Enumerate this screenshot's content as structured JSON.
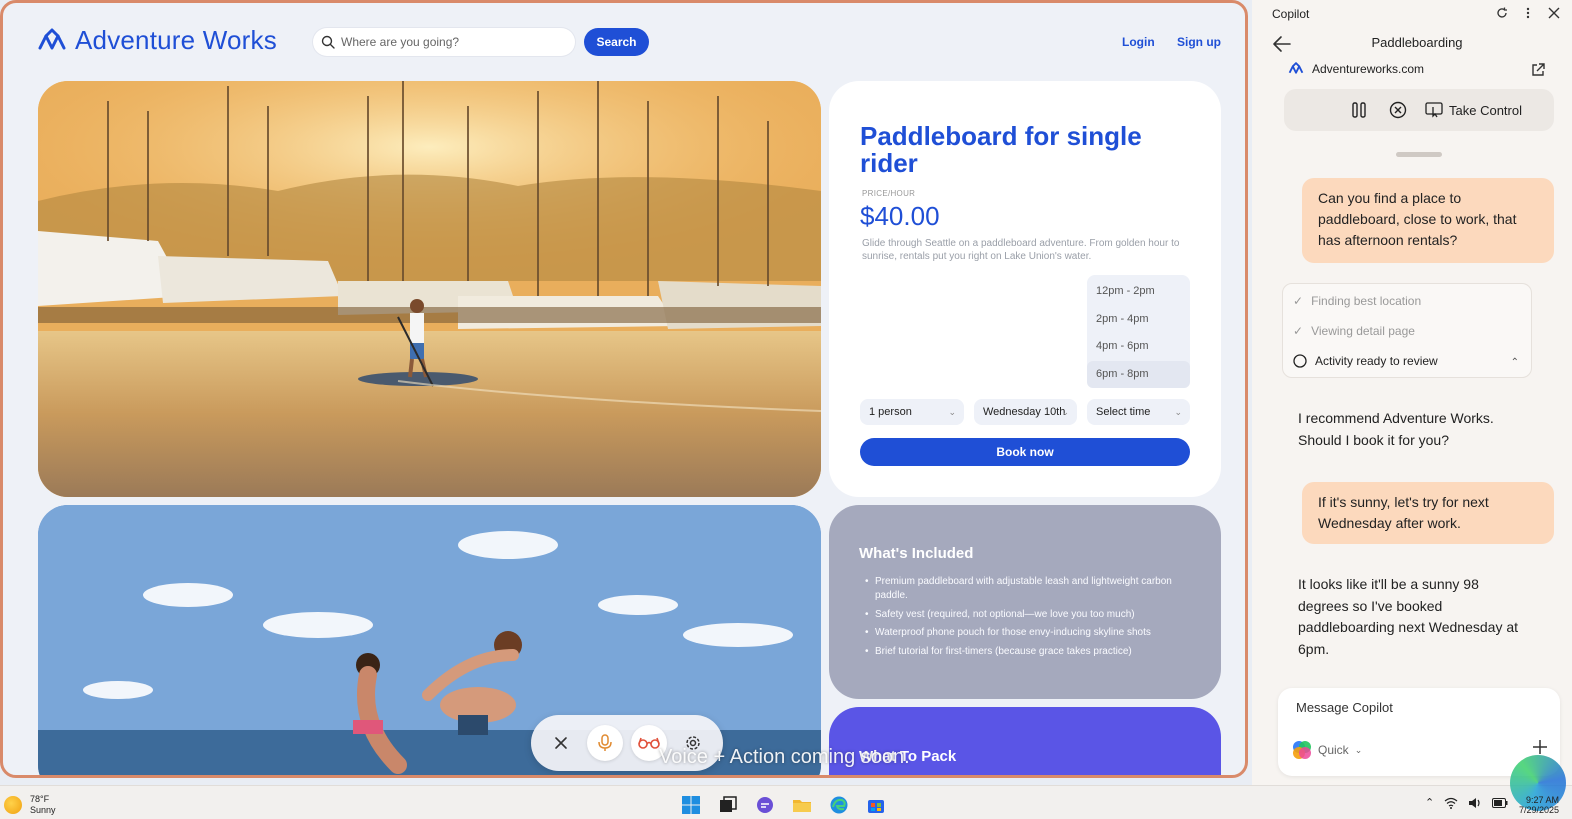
{
  "site": {
    "brand": "Adventure Works",
    "search_placeholder": "Where are you going?",
    "search_button": "Search",
    "login": "Login",
    "signup": "Sign up"
  },
  "product": {
    "title": "Paddleboard for single rider",
    "price_label": "PRICE/HOUR",
    "price": "$40.00",
    "description": "Glide through Seattle on a paddleboard adventure. From golden hour to sunrise, rentals put you right on Lake Union's water.",
    "time_options": [
      "12pm - 2pm",
      "2pm - 4pm",
      "4pm - 6pm",
      "6pm - 8pm"
    ],
    "people_select": "1 person",
    "date_select": "Wednesday 10th",
    "time_select": "Select time",
    "book_button": "Book now"
  },
  "included": {
    "title": "What's Included",
    "items": [
      "Premium paddleboard with adjustable leash and lightweight carbon paddle.",
      "Safety vest (required, not optional—we love you too much)",
      "Waterproof phone pouch for those envy-inducing skyline shots",
      "Brief tutorial for first-timers (because grace takes practice)"
    ]
  },
  "pack": {
    "title": "What To Pack"
  },
  "voice": {
    "caption": "Voice + Action coming soon."
  },
  "copilot": {
    "app_title": "Copilot",
    "heading": "Paddleboarding",
    "site": "Adventureworks.com",
    "take_control": "Take Control",
    "user_msg_1": "Can you find a place to paddleboard, close to work, that has afternoon rentals?",
    "steps": [
      {
        "label": "Finding best location",
        "state": "done"
      },
      {
        "label": "Viewing detail page",
        "state": "done"
      },
      {
        "label": "Activity ready to review",
        "state": "active"
      }
    ],
    "bot_msg_1": "I recommend Adventure Works. Should I book it for you?",
    "user_msg_2": "If it's sunny, let's try for next Wednesday after work.",
    "bot_msg_2": "It looks like it'll be a sunny 98 degrees so I've booked paddleboarding next Wednesday at 6pm.",
    "composer_placeholder": "Message Copilot",
    "mode": "Quick"
  },
  "taskbar": {
    "temp": "78°F",
    "condition": "Sunny",
    "time": "9:27 AM",
    "date": "7/29/2025"
  },
  "colors": {
    "brand_blue": "#1f4fd6",
    "user_bubble": "#fcd9bd",
    "pack_purple": "#5a55e6",
    "frame": "#d98a6a"
  }
}
